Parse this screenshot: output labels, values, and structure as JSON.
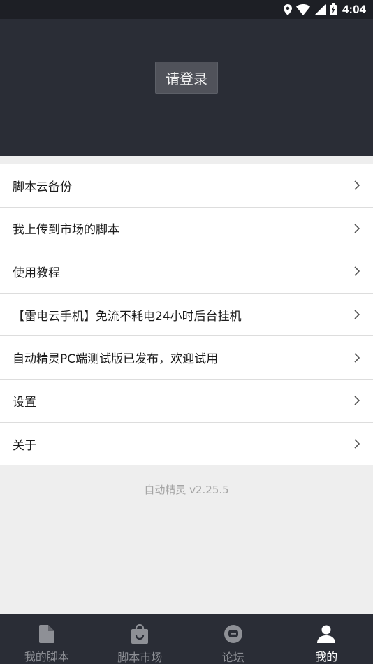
{
  "status_bar": {
    "time": "4:04",
    "icons": [
      "location-icon",
      "wifi-icon",
      "signal-icon",
      "battery-icon"
    ]
  },
  "header": {
    "login_label": "请登录"
  },
  "menu": {
    "items": [
      {
        "label": "脚本云备份"
      },
      {
        "label": "我上传到市场的脚本"
      },
      {
        "label": "使用教程"
      },
      {
        "label": "【雷电云手机】免流不耗电24小时后台挂机"
      },
      {
        "label": "自动精灵PC端测试版已发布，欢迎试用"
      },
      {
        "label": "设置"
      },
      {
        "label": "关于"
      }
    ]
  },
  "version": "自动精灵 v2.25.5",
  "bottom_nav": {
    "tabs": [
      {
        "label": "我的脚本",
        "icon": "file-icon",
        "active": false
      },
      {
        "label": "脚本市场",
        "icon": "shopping-bag-icon",
        "active": false
      },
      {
        "label": "论坛",
        "icon": "forum-icon",
        "active": false
      },
      {
        "label": "我的",
        "icon": "user-icon",
        "active": true
      }
    ]
  },
  "colors": {
    "header_bg": "#2a2d36",
    "status_bg": "#1d1f25",
    "page_bg": "#eeeeee",
    "active_tab": "#ffffff",
    "inactive_tab": "#8e9096"
  }
}
